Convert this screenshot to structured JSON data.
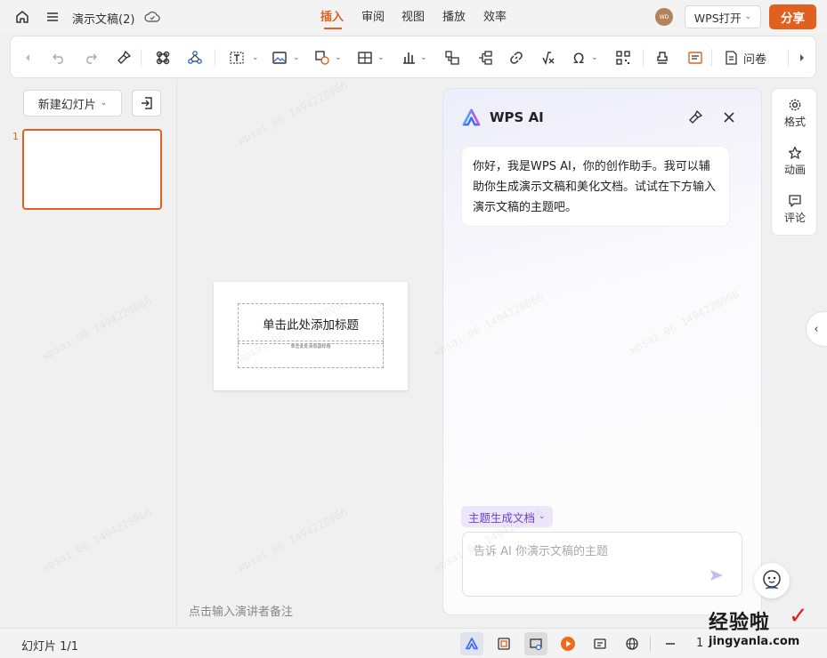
{
  "topbar": {
    "doc_title": "演示文稿(2)",
    "tabs": [
      {
        "label": "插入",
        "active": true
      },
      {
        "label": "审阅",
        "active": false
      },
      {
        "label": "视图",
        "active": false
      },
      {
        "label": "播放",
        "active": false
      },
      {
        "label": "效率",
        "active": false
      }
    ],
    "avatar_text": "WD",
    "open_with_label": "WPS打开",
    "share_label": "分享"
  },
  "toolbar": {
    "survey_label": "问卷",
    "icons": [
      "prev-arrow-icon",
      "undo-icon",
      "redo-icon",
      "format-painter-icon",
      "shape-cmd-icon",
      "smartart-icon",
      "textbox-icon",
      "image-icon",
      "shape-icon",
      "table-icon",
      "chart-icon",
      "crop-icon",
      "flowchart-icon",
      "link-icon",
      "formula-icon",
      "symbol-icon",
      "qrcode-icon",
      "stamp-icon",
      "media-icon",
      "survey-icon",
      "next-arrow-icon"
    ]
  },
  "slides_panel": {
    "new_slide_label": "新建幻灯片",
    "slide_number": "1"
  },
  "slide": {
    "title_placeholder": "单击此处添加标题",
    "subtitle_placeholder": "单击此处添加副标题"
  },
  "notes_placeholder": "点击输入演讲者备注",
  "ai": {
    "title": "WPS AI",
    "greeting": "你好，我是WPS AI，你的创作助手。我可以辅助你生成演示文稿和美化文档。试试在下方输入演示文稿的主题吧。",
    "mode_label": "主题生成文档",
    "input_placeholder": "告诉 AI 你演示文稿的主题"
  },
  "right_panel": {
    "items": [
      {
        "label": "格式"
      },
      {
        "label": "动画"
      },
      {
        "label": "评论"
      }
    ]
  },
  "status": {
    "slide_count": "幻灯片 1/1",
    "zoom_partial": "1"
  },
  "watermark": {
    "text": "wpsai_06 1494228066",
    "brand_text": "经验啦",
    "brand_url": "jingyanla.com"
  },
  "colors": {
    "accent": "#e0611f",
    "ai_purple": "#6a3fd1"
  }
}
